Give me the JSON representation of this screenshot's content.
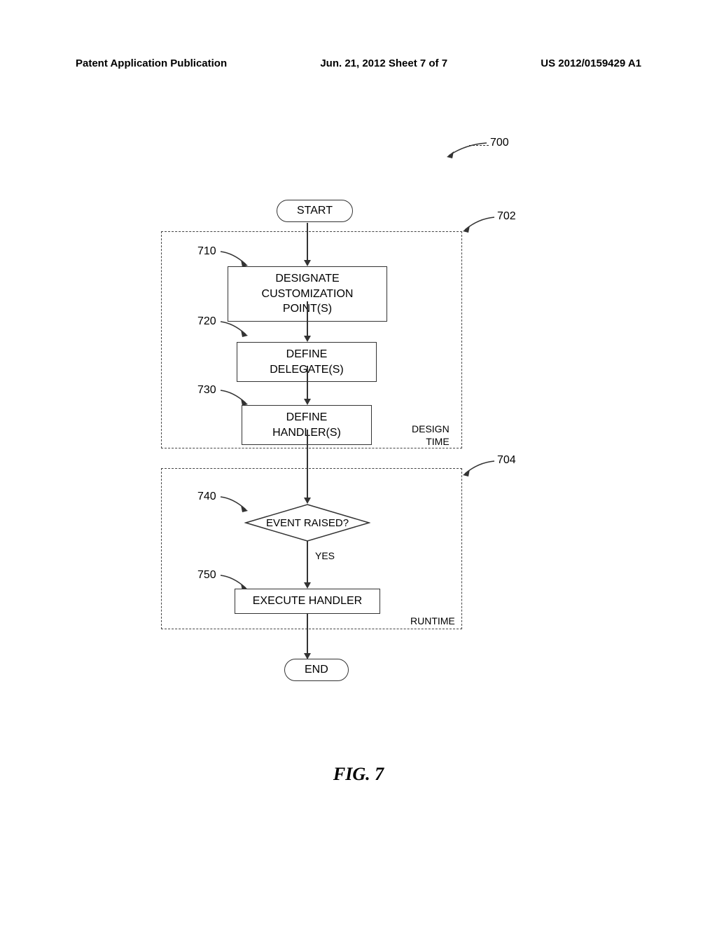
{
  "header": {
    "left": "Patent Application Publication",
    "center": "Jun. 21, 2012  Sheet 7 of 7",
    "right": "US 2012/0159429 A1"
  },
  "refs": {
    "r700": "700",
    "r702": "702",
    "r704": "704",
    "r710": "710",
    "r720": "720",
    "r730": "730",
    "r740": "740",
    "r750": "750"
  },
  "flow": {
    "start": "START",
    "end": "END",
    "step710": "DESIGNATE\nCUSTOMIZATION POINT(S)",
    "step720": "DEFINE DELEGATE(S)",
    "step730": "DEFINE HANDLER(S)",
    "decision740": "EVENT RAISED?",
    "yes": "YES",
    "step750": "EXECUTE HANDLER"
  },
  "phases": {
    "design": "DESIGN\nTIME",
    "runtime": "RUNTIME"
  },
  "caption": "FIG. 7",
  "chart_data": {
    "type": "flowchart",
    "title": "FIG. 7",
    "diagram_ref": "700",
    "phases": [
      {
        "id": "702",
        "name": "DESIGN TIME",
        "steps": [
          "710",
          "720",
          "730"
        ]
      },
      {
        "id": "704",
        "name": "RUNTIME",
        "steps": [
          "740",
          "750"
        ]
      }
    ],
    "nodes": [
      {
        "id": "start",
        "type": "terminator",
        "label": "START"
      },
      {
        "id": "710",
        "type": "process",
        "label": "DESIGNATE CUSTOMIZATION POINT(S)"
      },
      {
        "id": "720",
        "type": "process",
        "label": "DEFINE DELEGATE(S)"
      },
      {
        "id": "730",
        "type": "process",
        "label": "DEFINE HANDLER(S)"
      },
      {
        "id": "740",
        "type": "decision",
        "label": "EVENT RAISED?"
      },
      {
        "id": "750",
        "type": "process",
        "label": "EXECUTE HANDLER"
      },
      {
        "id": "end",
        "type": "terminator",
        "label": "END"
      }
    ],
    "edges": [
      {
        "from": "start",
        "to": "710"
      },
      {
        "from": "710",
        "to": "720"
      },
      {
        "from": "720",
        "to": "730"
      },
      {
        "from": "730",
        "to": "740"
      },
      {
        "from": "740",
        "to": "750",
        "label": "YES"
      },
      {
        "from": "750",
        "to": "end"
      }
    ]
  }
}
